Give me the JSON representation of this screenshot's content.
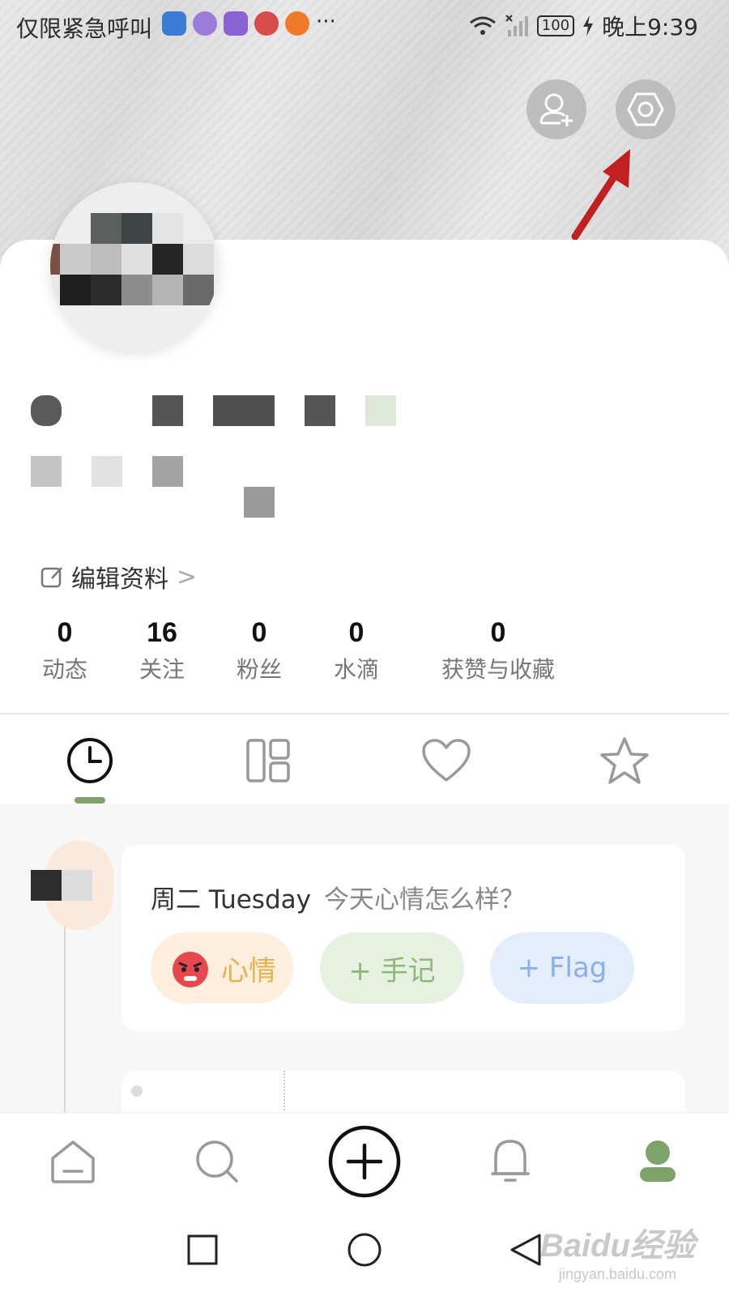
{
  "status_bar": {
    "carrier": "仅限紧急呼叫",
    "more": "···",
    "battery": "100",
    "time": "晚上9:39",
    "app_icon_colors": [
      "#3a7bd5",
      "#9b7bd9",
      "#8a63d2",
      "#d84b4b",
      "#f07a2a"
    ]
  },
  "profile": {
    "edit_label": "编辑资料",
    "edit_chevron": ">"
  },
  "stats": [
    {
      "value": "0",
      "label": "动态"
    },
    {
      "value": "16",
      "label": "关注"
    },
    {
      "value": "0",
      "label": "粉丝"
    },
    {
      "value": "0",
      "label": "水滴"
    },
    {
      "value": "0",
      "label": "获赞与收藏"
    }
  ],
  "tabs": [
    {
      "icon": "clock-icon",
      "active": true
    },
    {
      "icon": "grid-layout-icon",
      "active": false
    },
    {
      "icon": "heart-icon",
      "active": false
    },
    {
      "icon": "star-icon",
      "active": false
    }
  ],
  "mood_card": {
    "date": "周二 Tuesday",
    "question": "今天心情怎么样？",
    "mood_label": "心情",
    "note_label": "+ 手记",
    "flag_label": "+ Flag"
  },
  "colors": {
    "accent_green": "#7ea36a",
    "annotation_arrow": "#c0201f",
    "mood_pill_bg": "#fdeedd",
    "note_pill_bg": "#e6f1df",
    "flag_pill_bg": "#e3edfb"
  },
  "watermark": {
    "main": "Baidu经验",
    "sub": "jingyan.baidu.com"
  }
}
